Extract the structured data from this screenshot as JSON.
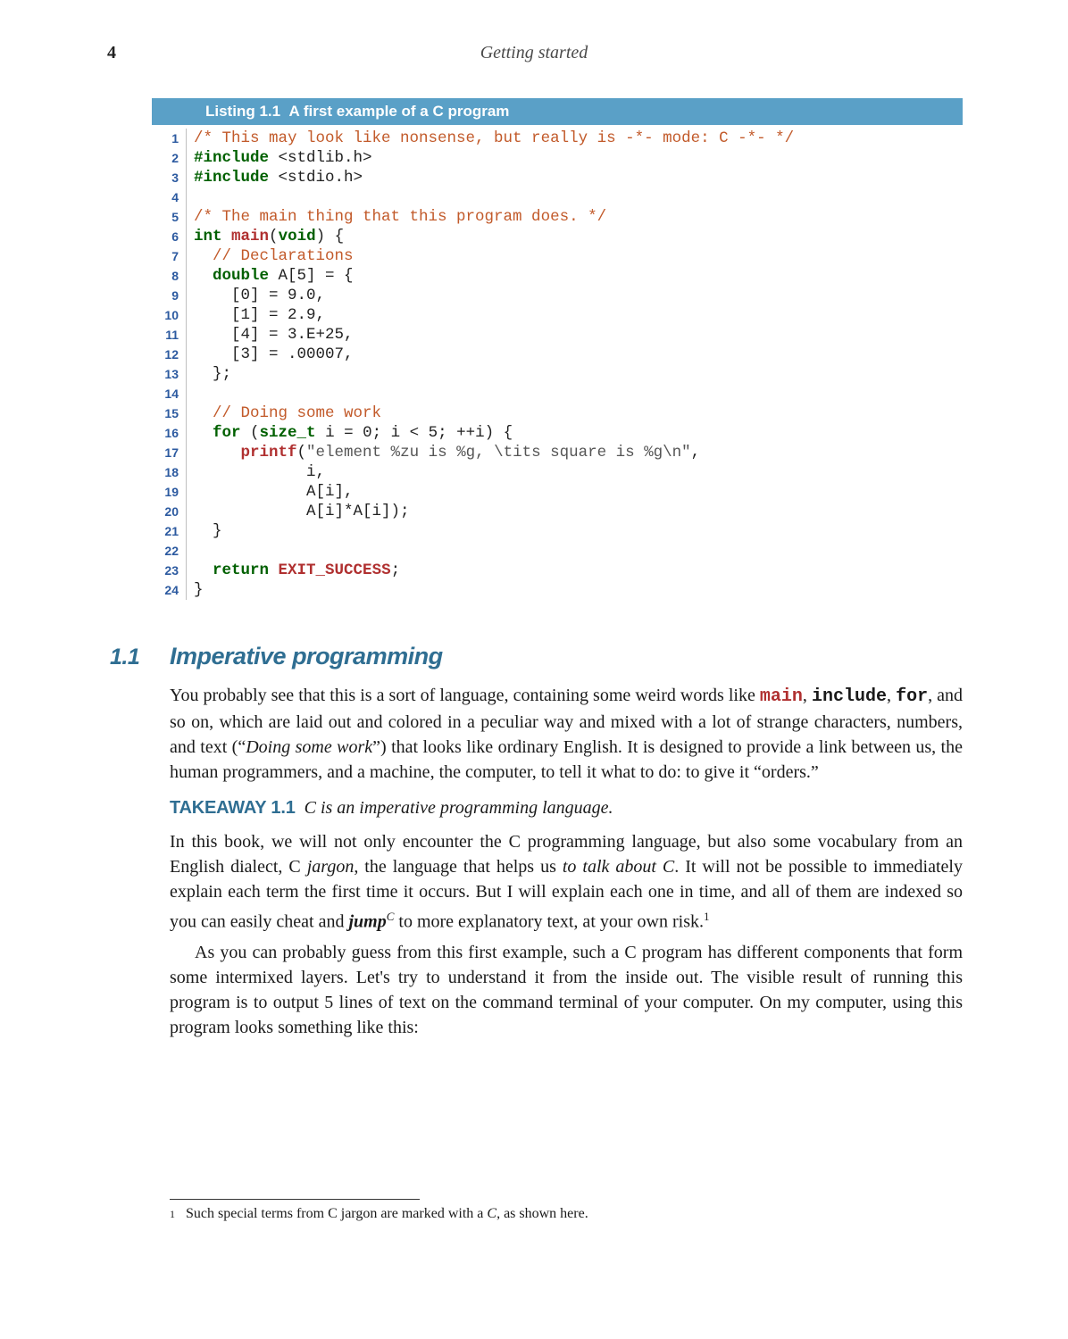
{
  "page_number": "4",
  "header": "Getting started",
  "listing": {
    "label": "Listing 1.1",
    "title": "A first example of a C program",
    "lines": [
      {
        "n": "1",
        "html": "<span class='cm'>/* This may look like nonsense, but really is -*- mode: C -*- */</span>"
      },
      {
        "n": "2",
        "html": "<span class='kw'>#include</span> &lt;stdlib.h&gt;"
      },
      {
        "n": "3",
        "html": "<span class='kw'>#include</span> &lt;stdio.h&gt;"
      },
      {
        "n": "4",
        "html": ""
      },
      {
        "n": "5",
        "html": "<span class='cm'>/* The main thing that this program does. */</span>"
      },
      {
        "n": "6",
        "html": "<span class='kw'>int</span> <span class='fn'>main</span>(<span class='kw'>void</span>) {"
      },
      {
        "n": "7",
        "html": "  <span class='cm'>// Declarations</span>"
      },
      {
        "n": "8",
        "html": "  <span class='kw'>double</span> A[5] = {"
      },
      {
        "n": "9",
        "html": "    [0] = 9.0,"
      },
      {
        "n": "10",
        "html": "    [1] = 2.9,"
      },
      {
        "n": "11",
        "html": "    [4] = 3.E+25,"
      },
      {
        "n": "12",
        "html": "    [3] = .00007,"
      },
      {
        "n": "13",
        "html": "  };"
      },
      {
        "n": "14",
        "html": ""
      },
      {
        "n": "15",
        "html": "  <span class='cm'>// Doing some work</span>"
      },
      {
        "n": "16",
        "html": "  <span class='kw'>for</span> (<span class='kw'>size_t</span> i = 0; i &lt; 5; ++i) {"
      },
      {
        "n": "17",
        "html": "     <span class='fn'>printf</span>(<span class='str'>\"element %zu is %g, \\tits square is %g\\n\"</span>,"
      },
      {
        "n": "18",
        "html": "            i,"
      },
      {
        "n": "19",
        "html": "            A[i],"
      },
      {
        "n": "20",
        "html": "            A[i]*A[i]);"
      },
      {
        "n": "21",
        "html": "  }"
      },
      {
        "n": "22",
        "html": ""
      },
      {
        "n": "23",
        "html": "  <span class='kw'>return</span> <span class='fn'>EXIT_SUCCESS</span>;"
      },
      {
        "n": "24",
        "html": "}"
      }
    ]
  },
  "section": {
    "number": "1.1",
    "title": "Imperative programming",
    "para1_html": "You probably see that this is a sort of language, containing some weird words like <span class='mono-red'>main</span>, <span class='mono'>include</span>, <span class='mono'>for</span>, and so on, which are laid out and colored in a peculiar way and mixed with a lot of strange characters, numbers, and text (“<i>Doing some work</i>”) that looks like ordinary English. It is designed to provide a link between us, the human programmers, and a machine, the computer, to tell it what to do: to give it “orders.”",
    "takeaway_label": "TAKEAWAY 1.1",
    "takeaway_text": "C is an imperative programming language.",
    "para2_html": "In this book, we will not only encounter the C programming language, but also some vocabulary from an English dialect, C <i>jargon</i>, the language that helps us <i>to talk about C</i>. It will not be possible to immediately explain each term the first time it occurs. But I will explain each one in time, and all of them are indexed so you can easily cheat and <span class='jump'>jump</span><span class='jump-sup'>C</span> to more explanatory text, at your own risk.<sup style='font-size:13px'>1</sup>",
    "para3_html": "As you can probably guess from this first example, such a C program has different components that form some intermixed layers. Let's try to understand it from the inside out. The visible result of running this program is to output 5 lines of text on the command terminal of your computer. On my computer, using this program looks something like this:"
  },
  "footnote": {
    "num": "1",
    "text_html": "Such special terms from C jargon are marked with a <span class='foot-c'>C</span>, as shown here."
  }
}
